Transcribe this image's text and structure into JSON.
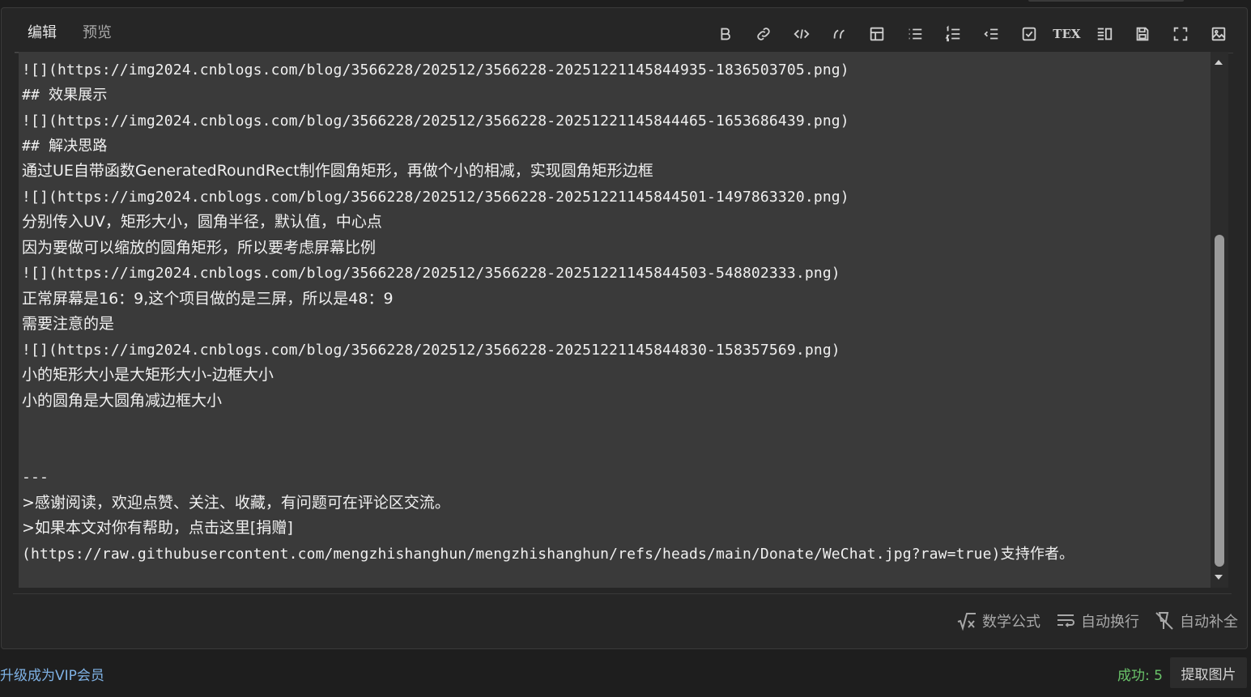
{
  "tabs": [
    {
      "label": "编辑"
    },
    {
      "label": "预览"
    }
  ],
  "toolbar": {
    "items": [
      {
        "name": "bold-icon"
      },
      {
        "name": "link-icon"
      },
      {
        "name": "code-icon"
      },
      {
        "name": "quote-icon"
      },
      {
        "name": "table-icon"
      },
      {
        "name": "unordered-list-icon"
      },
      {
        "name": "ordered-list-icon"
      },
      {
        "name": "indent-icon"
      },
      {
        "name": "checkbox-icon"
      },
      {
        "name": "tex-icon",
        "text": "TEX"
      },
      {
        "name": "split-view-icon"
      },
      {
        "name": "save-icon"
      },
      {
        "name": "fullscreen-icon"
      },
      {
        "name": "image-icon"
      }
    ]
  },
  "editor": {
    "lines": [
      {
        "text": "![](https://img2024.cnblogs.com/blog/3566228/202512/3566228-20251221145844935-1836503705.png)"
      },
      {
        "text": "## 效果展示"
      },
      {
        "text": "![](https://img2024.cnblogs.com/blog/3566228/202512/3566228-20251221145844465-1653686439.png)"
      },
      {
        "text": "## 解决思路"
      },
      {
        "text": "通过UE自带函数GeneratedRoundRect制作圆角矩形，再做个小的相减，实现圆角矩形边框"
      },
      {
        "text": "![](https://img2024.cnblogs.com/blog/3566228/202512/3566228-20251221145844501-1497863320.png)"
      },
      {
        "text": "分别传入UV，矩形大小，圆角半径，默认值，中心点"
      },
      {
        "text": "因为要做可以缩放的圆角矩形，所以要考虑屏幕比例"
      },
      {
        "text": "![](https://img2024.cnblogs.com/blog/3566228/202512/3566228-20251221145844503-548802333.png)"
      },
      {
        "text": "正常屏幕是16：9,这个项目做的是三屏，所以是48：9"
      },
      {
        "text": "需要注意的是"
      },
      {
        "text": "![](https://img2024.cnblogs.com/blog/3566228/202512/3566228-20251221145844830-158357569.png)"
      },
      {
        "text": "小的矩形大小是大矩形大小-边框大小"
      },
      {
        "text": "小的圆角是大圆角减边框大小"
      },
      {
        "text": ""
      },
      {
        "text": ""
      },
      {
        "text": "---"
      },
      {
        "text": ">感谢阅读，欢迎点赞、关注、收藏，有问题可在评论区交流。"
      },
      {
        "text": ">如果本文对你有帮助，点击这里[捐赠]"
      },
      {
        "text": "(https://raw.githubusercontent.com/mengzhishanghun/mengzhishanghun/refs/heads/main/Donate/WeChat.jpg?raw=true)支持作者。"
      }
    ]
  },
  "footer": {
    "math_label": "数学公式",
    "wrap_label": "自动换行",
    "autocomplete_label": "自动补全"
  },
  "bottom": {
    "vip_link": "升级成为VIP会员",
    "status": "成功: 5",
    "extract_button": "提取图片"
  }
}
